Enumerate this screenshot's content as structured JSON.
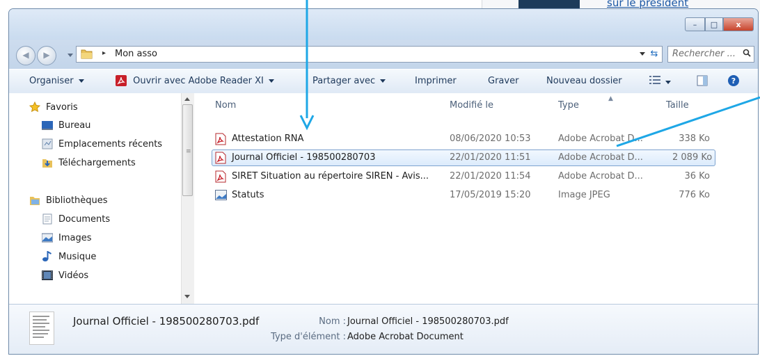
{
  "background": {
    "link_text": "sur le président"
  },
  "window": {
    "controls": {
      "minimize": "–",
      "maximize": "□",
      "close": "x"
    }
  },
  "address": {
    "path_separator": "▸",
    "path": "Mon asso",
    "search_placeholder": "Rechercher ..."
  },
  "toolbar": {
    "organize": "Organiser",
    "open_with": "Ouvrir avec Adobe Reader XI",
    "share": "Partager avec",
    "print": "Imprimer",
    "burn": "Graver",
    "new_folder": "Nouveau dossier"
  },
  "sidebar": {
    "favorites": "Favoris",
    "favorites_items": [
      "Bureau",
      "Emplacements récents",
      "Téléchargements"
    ],
    "libraries": "Bibliothèques",
    "libraries_items": [
      "Documents",
      "Images",
      "Musique",
      "Vidéos"
    ]
  },
  "file_list": {
    "columns": {
      "name": "Nom",
      "modified": "Modifié le",
      "type": "Type",
      "size": "Taille"
    },
    "rows": [
      {
        "name": "Attestation RNA",
        "modified": "08/06/2020 10:53",
        "type": "Adobe Acrobat D...",
        "size": "338 Ko",
        "icon": "pdf-icon"
      },
      {
        "name": "Journal Officiel - 198500280703",
        "modified": "22/01/2020 11:51",
        "type": "Adobe Acrobat D...",
        "size": "2 089 Ko",
        "icon": "pdf-icon",
        "selected": true
      },
      {
        "name": "SIRET Situation au répertoire SIREN - Avis...",
        "modified": "22/01/2020 11:54",
        "type": "Adobe Acrobat D...",
        "size": "36 Ko",
        "icon": "pdf-icon"
      },
      {
        "name": "Statuts",
        "modified": "17/05/2019 15:20",
        "type": "Image JPEG",
        "size": "776 Ko",
        "icon": "image-icon"
      }
    ]
  },
  "details": {
    "filename": "Journal Officiel - 198500280703.pdf",
    "name_label": "Nom :",
    "name_value": "Journal Officiel - 198500280703.pdf",
    "type_label": "Type d'élément :",
    "type_value": "Adobe Acrobat Document"
  },
  "colors": {
    "callout_arrow": "#1ea7e6",
    "selection_border": "#7da2ce",
    "pdf_red": "#c8202a"
  }
}
